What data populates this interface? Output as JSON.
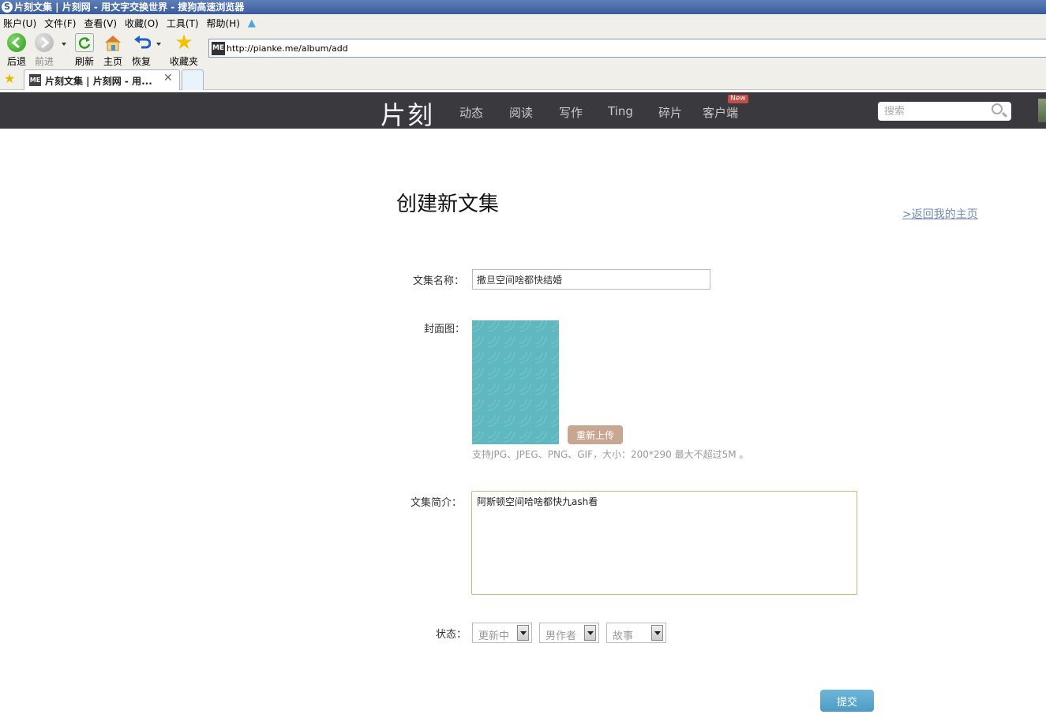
{
  "window": {
    "title": "片刻文集 | 片刻网 - 用文字交换世界 - 搜狗高速浏览器",
    "logo_char": "S"
  },
  "menu": {
    "items": [
      "账户(U)",
      "文件(F)",
      "查看(V)",
      "收藏(O)",
      "工具(T)",
      "帮助(H)"
    ],
    "extra_icon": "tshirt-icon"
  },
  "toolbar": {
    "back_label": "后退",
    "forward_label": "前进",
    "refresh_label": "刷新",
    "home_label": "主页",
    "restore_label": "恢复",
    "favorites_label": "收藏夹"
  },
  "address": {
    "url": "http://pianke.me/album/add",
    "favicon_text": "ME"
  },
  "tabs": [
    {
      "title": "片刻文集 | 片刻网 - 用...",
      "favicon_text": "ME"
    }
  ],
  "site": {
    "logo": "片刻",
    "nav": [
      "动态",
      "阅读",
      "写作",
      "Ting",
      "碎片",
      "客户端"
    ],
    "new_badge": "New",
    "search_placeholder": "搜索"
  },
  "form": {
    "page_title": "创建新文集",
    "back_link": ">返回我的主页",
    "name_label": "文集名称：",
    "name_value": "撒旦空间啥都快结婚",
    "cover_label": "封面图：",
    "reupload_label": "重新上传",
    "cover_hint": "支持JPG、JPEG、PNG、GIF，大小：200*290 最大不超过5M 。",
    "intro_label": "文集简介：",
    "intro_value": "阿斯顿空间哈啥都快九ash看",
    "status_label": "状态：",
    "status_select": "更新中",
    "author_select": "男作者",
    "type_select": "故事",
    "submit_label": "提交"
  },
  "colors": {
    "site_nav_bg": "#3a3a3e",
    "cover_bg": "#5fb8bf",
    "reupload_bg": "#c9a692",
    "submit_bg": "#5aa8cf",
    "link": "#6f8bb5"
  }
}
